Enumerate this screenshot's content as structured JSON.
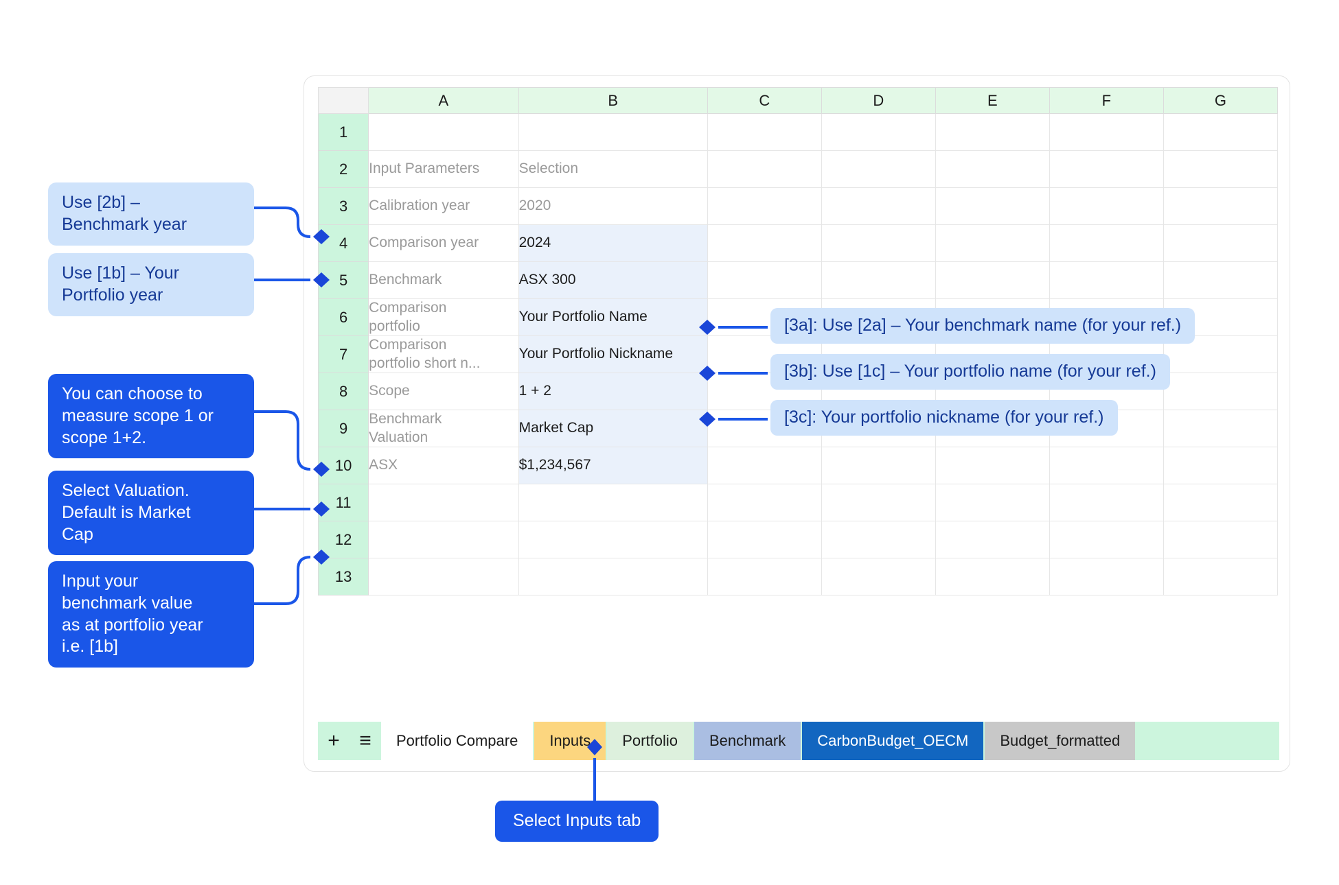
{
  "spreadsheet": {
    "column_headers": [
      "A",
      "B",
      "C",
      "D",
      "E",
      "F",
      "G"
    ],
    "row_numbers": [
      "1",
      "2",
      "3",
      "4",
      "5",
      "6",
      "7",
      "8",
      "9",
      "10",
      "11",
      "12",
      "13"
    ],
    "rows": [
      {
        "num": "1",
        "a": "",
        "b": ""
      },
      {
        "num": "2",
        "a": "Input Parameters",
        "b": "Selection"
      },
      {
        "num": "3",
        "a": "Calibration year",
        "b": "2020"
      },
      {
        "num": "4",
        "a": "Comparison year",
        "b": "2024"
      },
      {
        "num": "5",
        "a": "Benchmark",
        "b": "ASX 300"
      },
      {
        "num": "6",
        "a": "Comparison\nportfolio",
        "b": "Your Portfolio Name"
      },
      {
        "num": "7",
        "a": "Comparison\nportfolio short n...",
        "b": "Your Portfolio Nickname"
      },
      {
        "num": "8",
        "a": "Scope",
        "b": "1 + 2"
      },
      {
        "num": "9",
        "a": "Benchmark\nValuation",
        "b": "Market Cap"
      },
      {
        "num": "10",
        "a": "ASX",
        "b": "$1,234,567"
      },
      {
        "num": "11",
        "a": "",
        "b": ""
      },
      {
        "num": "12",
        "a": "",
        "b": ""
      },
      {
        "num": "13",
        "a": "",
        "b": ""
      }
    ]
  },
  "tabbar": {
    "add_label": "+",
    "menu_label": "≡",
    "tabs": [
      {
        "label": "Portfolio Compare",
        "style": "white"
      },
      {
        "label": "Inputs",
        "style": "amber"
      },
      {
        "label": "Portfolio",
        "style": "palegrn"
      },
      {
        "label": "Benchmark",
        "style": "periwinkle"
      },
      {
        "label": "CarbonBudget_OECM",
        "style": "strongblue"
      },
      {
        "label": "Budget_formatted",
        "style": "gray"
      }
    ]
  },
  "callouts": {
    "left": [
      {
        "text": "Use [2b] –\nBenchmark year",
        "style": "light"
      },
      {
        "text": "Use [1b] – Your\nPortfolio year",
        "style": "light"
      },
      {
        "text": "You can choose to\nmeasure scope 1 or\nscope 1+2.",
        "style": "dark"
      },
      {
        "text": "Select Valuation.\nDefault is Market\nCap",
        "style": "dark"
      },
      {
        "text": "Input your\nbenchmark value\nas at portfolio year\ni.e. [1b]",
        "style": "dark"
      }
    ],
    "right": [
      {
        "text": "[3a]: Use [2a] – Your benchmark name (for your ref.)",
        "style": "light"
      },
      {
        "text": "[3b]: Use [1c] – Your portfolio name (for your ref.)",
        "style": "light"
      },
      {
        "text": "[3c]: Your portfolio nickname (for your ref.)",
        "style": "light"
      }
    ],
    "bottom": {
      "text": "Select Inputs tab",
      "style": "dark"
    }
  },
  "colors": {
    "accent_blue": "#1a56e8",
    "callout_light_bg": "#cfe3fb",
    "callout_light_text": "#163a96",
    "row_header_green": "#ccf5dd",
    "col_header_green": "#e3f9e7",
    "value_cell_blue": "#eaf1fb",
    "tab_active_amber": "#fcd67f"
  }
}
